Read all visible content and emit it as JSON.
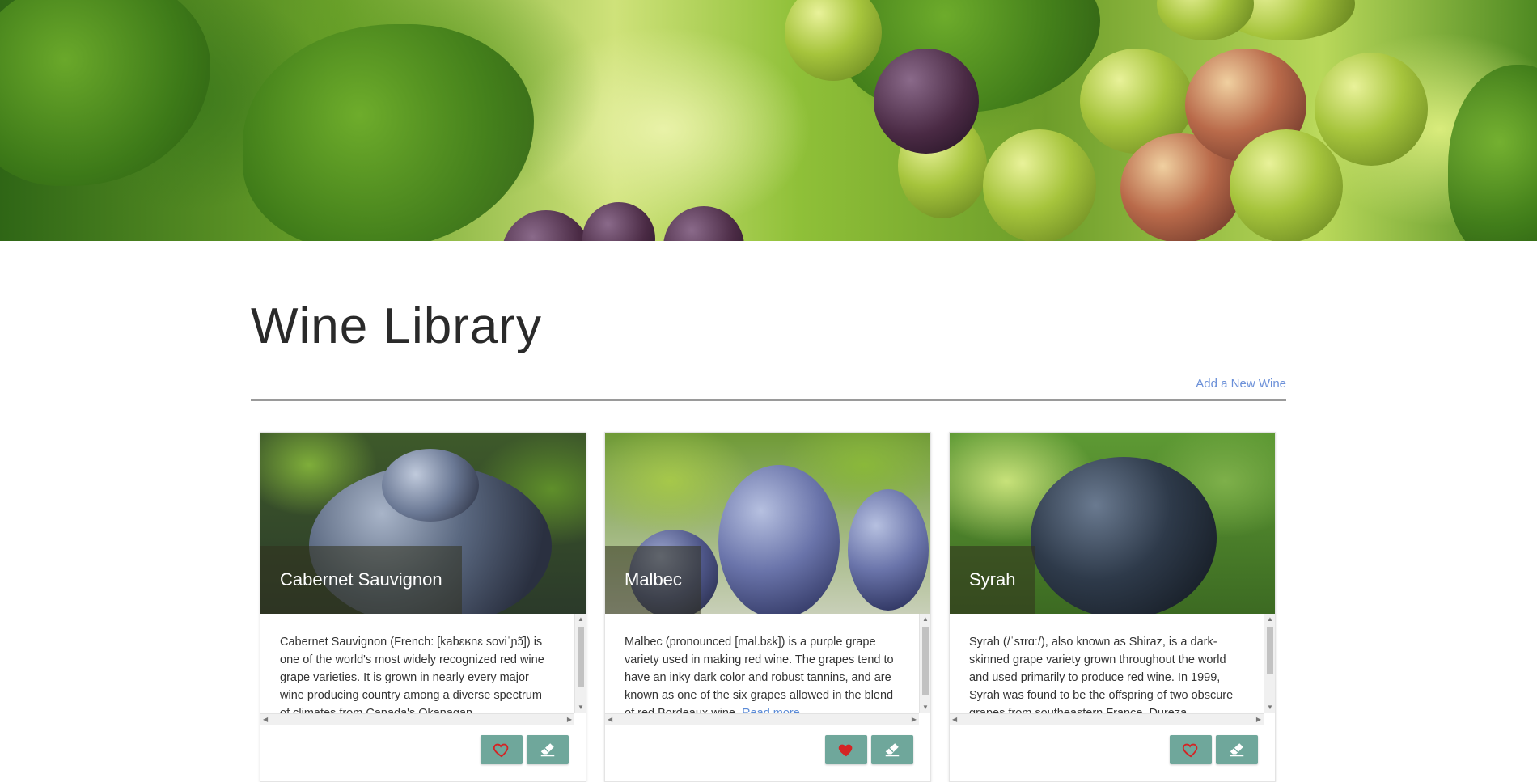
{
  "page": {
    "title": "Wine Library",
    "add_link": "Add a New Wine"
  },
  "colors": {
    "accent_button": "#6fa79b",
    "link": "#6a8fd8",
    "heart_active": "#d42424"
  },
  "wines": [
    {
      "name": "Cabernet Sauvignon",
      "description": "Cabernet Sauvignon (French: [kabɛʁnɛ soviˈɲɔ̃]) is one of the world's most widely recognized red wine grape varieties. It is grown in nearly every major wine producing country among a diverse spectrum of climates from Canada's Okanagan",
      "read_more": "",
      "favorite": false,
      "favorite_icon": "heart-outline-icon",
      "delete_icon": "eraser-icon"
    },
    {
      "name": "Malbec",
      "description": "Malbec (pronounced [mal.bɛk]) is a purple grape variety used in making red wine. The grapes tend to have an inky dark color and robust tannins, and are known as one of the six grapes allowed in the blend of red Bordeaux wine.",
      "read_more": "Read more.",
      "favorite": true,
      "favorite_icon": "heart-filled-icon",
      "delete_icon": "eraser-icon"
    },
    {
      "name": "Syrah",
      "description": "Syrah (/ˈsɪrɑː/), also known as Shiraz, is a dark-skinned grape variety grown throughout the world and used primarily to produce red wine. In 1999, Syrah was found to be the offspring of two obscure grapes from southeastern France, Dureza",
      "read_more": "",
      "favorite": false,
      "favorite_icon": "heart-outline-icon",
      "delete_icon": "eraser-icon"
    }
  ]
}
